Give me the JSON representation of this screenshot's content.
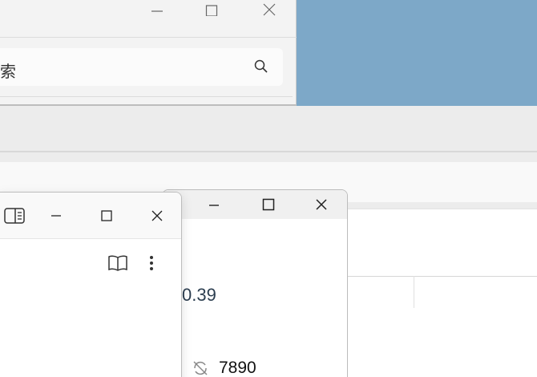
{
  "top_window": {
    "search": {
      "value": "索",
      "icon": "search-icon"
    },
    "controls": [
      "minimize-icon",
      "maximize-icon",
      "close-icon"
    ]
  },
  "calculator_window": {
    "display_value": "0.39",
    "row_value": "7890",
    "row_icon": "no-repeat-icon",
    "controls": [
      "minimize-icon",
      "maximize-icon",
      "close-icon"
    ]
  },
  "front_window": {
    "controls": [
      "reading-view-icon",
      "minimize-icon",
      "maximize-icon",
      "close-icon"
    ],
    "toolbar": [
      "book-icon",
      "more-options-icon"
    ]
  },
  "colors": {
    "wallpaper": "#7da8c8",
    "window_bg": "#f3f3f3",
    "text_dark": "#2c3e50"
  }
}
